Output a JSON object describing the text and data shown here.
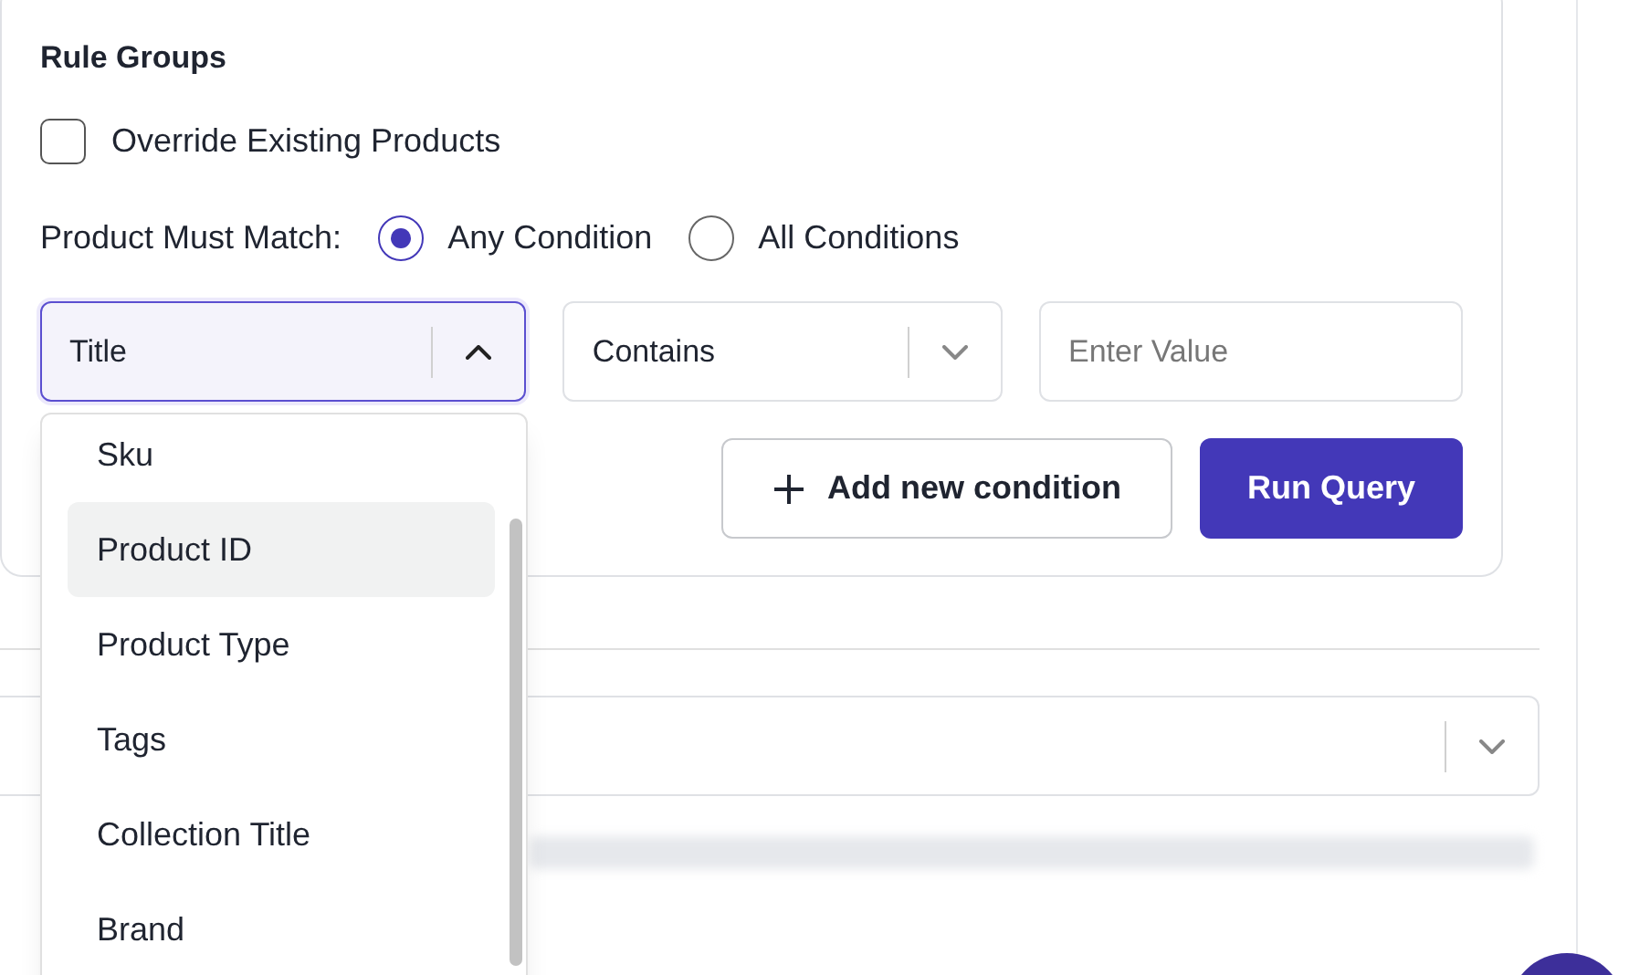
{
  "rule_groups": {
    "title": "Rule Groups",
    "override": {
      "label": "Override Existing Products",
      "checked": false
    },
    "match": {
      "label": "Product Must Match:",
      "options": [
        {
          "label": "Any Condition",
          "selected": true
        },
        {
          "label": "All Conditions",
          "selected": false
        }
      ]
    },
    "condition": {
      "field": {
        "value": "Title",
        "expanded": true
      },
      "operator": {
        "value": "Contains"
      },
      "value_input": {
        "placeholder": "Enter Value"
      }
    },
    "buttons": [
      {
        "kind": "secondary",
        "label": "Add new condition"
      },
      {
        "kind": "primary",
        "label": "Run Query"
      }
    ]
  },
  "field_dropdown": {
    "items": [
      {
        "label": "Sku",
        "selected": false
      },
      {
        "label": "Product ID",
        "selected": true
      },
      {
        "label": "Product Type",
        "selected": false
      },
      {
        "label": "Tags",
        "selected": false
      },
      {
        "label": "Collection Title",
        "selected": false
      },
      {
        "label": "Brand",
        "selected": false
      }
    ]
  }
}
